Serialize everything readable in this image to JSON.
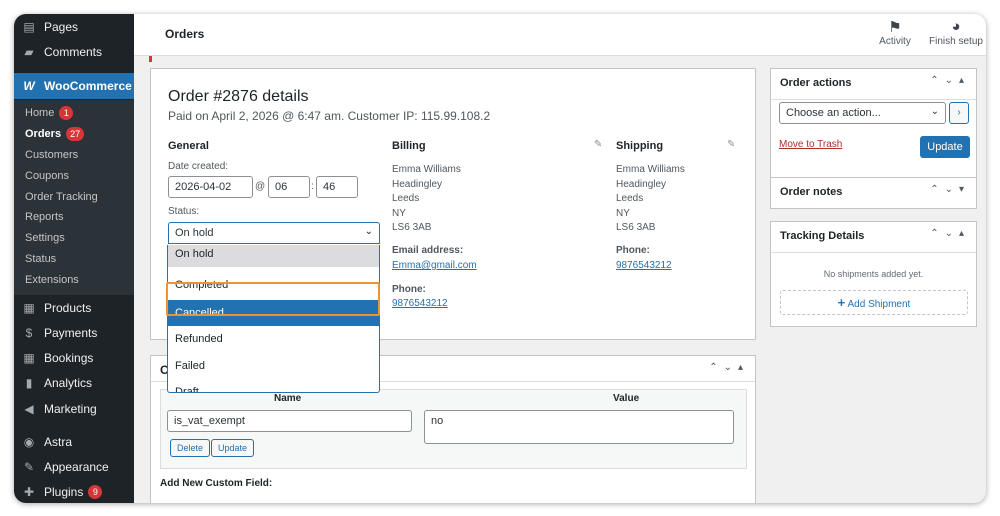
{
  "sidebar": {
    "items": [
      {
        "label": "Pages",
        "icon": "pages-icon"
      },
      {
        "label": "Comments",
        "icon": "comments-icon"
      },
      {
        "label": "WooCommerce",
        "icon": "woocommerce-icon"
      },
      {
        "label": "Products",
        "icon": "products-icon"
      },
      {
        "label": "Payments",
        "icon": "payments-icon"
      },
      {
        "label": "Bookings",
        "icon": "bookings-icon"
      },
      {
        "label": "Analytics",
        "icon": "analytics-icon"
      },
      {
        "label": "Marketing",
        "icon": "marketing-icon"
      },
      {
        "label": "Astra",
        "icon": "astra-icon"
      },
      {
        "label": "Appearance",
        "icon": "appearance-icon"
      },
      {
        "label": "Plugins",
        "icon": "plugins-icon",
        "badge": "9"
      }
    ],
    "woo_submenu": [
      {
        "label": "Home",
        "badge": "1"
      },
      {
        "label": "Orders",
        "badge": "27"
      },
      {
        "label": "Customers"
      },
      {
        "label": "Coupons"
      },
      {
        "label": "Order Tracking"
      },
      {
        "label": "Reports"
      },
      {
        "label": "Settings"
      },
      {
        "label": "Status"
      },
      {
        "label": "Extensions"
      }
    ]
  },
  "topbar": {
    "title": "Orders",
    "activity_label": "Activity",
    "finish_setup_label": "Finish setup"
  },
  "order": {
    "title": "Order #2876 details",
    "subtitle": "Paid on April 2, 2026 @ 6:47 am. Customer IP: 115.99.108.2",
    "general": {
      "heading": "General",
      "date_created_label": "Date created:",
      "date": "2026-04-02",
      "at": "@",
      "hour": "06",
      "colon": ":",
      "minute": "46",
      "status_label": "Status:",
      "status_value": "On hold"
    },
    "billing": {
      "heading": "Billing",
      "address": [
        "Emma Williams",
        "Headingley",
        "Leeds",
        "NY",
        "LS6 3AB"
      ],
      "email_label": "Email address:",
      "email": "Emma@gmail.com",
      "phone_label": "Phone:",
      "phone": "9876543212"
    },
    "shipping": {
      "heading": "Shipping",
      "address": [
        "Emma Williams",
        "Headingley",
        "Leeds",
        "NY",
        "LS6 3AB"
      ],
      "phone_label": "Phone:",
      "phone": "9876543212"
    }
  },
  "status_dropdown": {
    "options": [
      "On hold",
      "Completed",
      "Cancelled",
      "Refunded",
      "Failed",
      "Draft"
    ],
    "highlighted": "Cancelled"
  },
  "custom_fields": {
    "header_letter": "C",
    "name_col": "Name",
    "value_col": "Value",
    "field_name": "is_vat_exempt",
    "field_value": "no",
    "delete_label": "Delete",
    "update_label": "Update",
    "add_new_label": "Add New Custom Field:"
  },
  "order_actions": {
    "title": "Order actions",
    "select_value": "Choose an action...",
    "go_label": "›",
    "trash_label": "Move to Trash",
    "update_label": "Update"
  },
  "order_notes": {
    "title": "Order notes"
  },
  "tracking": {
    "title": "Tracking Details",
    "empty_text": "No shipments added yet.",
    "add_label": "Add Shipment"
  },
  "colors": {
    "sidebar_bg": "#1d2327",
    "accent": "#2271b1",
    "badge": "#d63638",
    "highlight_outline": "#e8953a"
  }
}
